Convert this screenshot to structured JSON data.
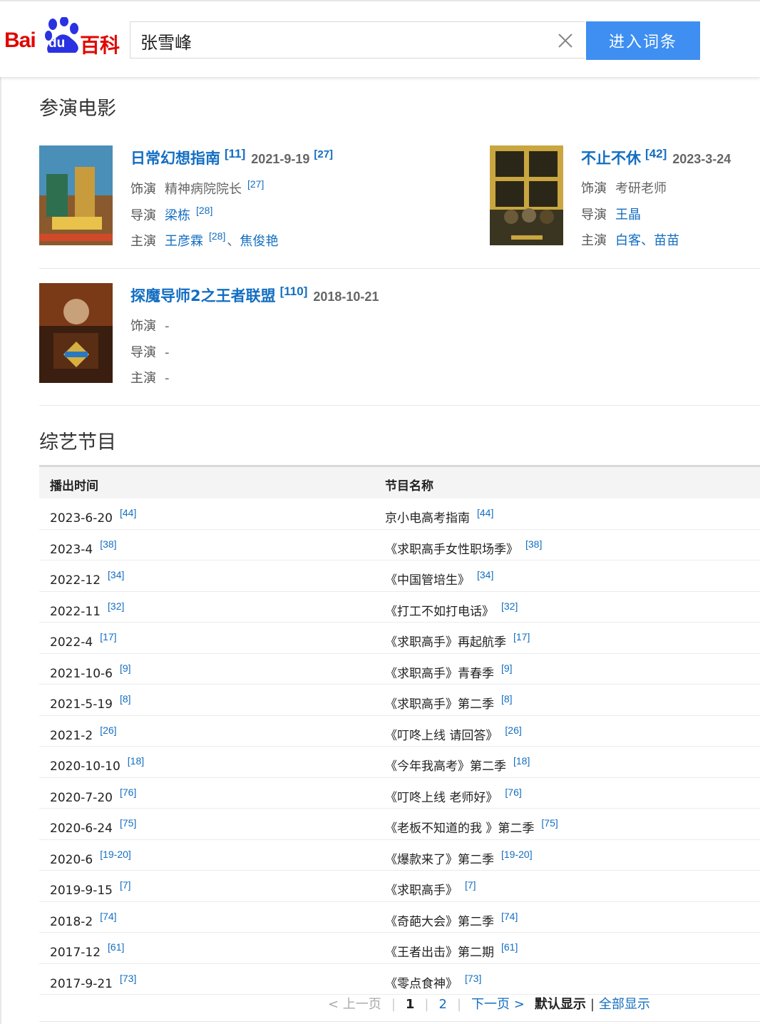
{
  "header": {
    "logo_bai": "Bai",
    "logo_du": "du",
    "logo_baike": "百科",
    "search_value": "张雪峰",
    "enter_button": "进入词条"
  },
  "films_section": {
    "title": "参演电影",
    "labels": {
      "role": "饰演",
      "director": "导演",
      "cast": "主演"
    },
    "films": [
      {
        "title": "日常幻想指南",
        "title_ref": "[11]",
        "date": "2021-9-19",
        "date_ref": "[27]",
        "role": "精神病院院长",
        "role_ref": "[27]",
        "director": "梁栋",
        "director_ref": "[28]",
        "cast_1": "王彦霖",
        "cast_1_ref": "[28]",
        "cast_sep": "、",
        "cast_2": "焦俊艳"
      },
      {
        "title": "不止不休",
        "title_ref": "[42]",
        "date": "2023-3-24",
        "role": "考研老师",
        "director": "王晶",
        "cast_1": "白客",
        "cast_sep": "、",
        "cast_2": "苗苗"
      },
      {
        "title": "探魔导师2之王者联盟",
        "title_ref": "[110]",
        "date": "2018-10-21",
        "role": "-",
        "director": "-",
        "cast": "-"
      }
    ]
  },
  "variety_section": {
    "title": "综艺节目",
    "headers": [
      "播出时间",
      "节目名称"
    ],
    "rows": [
      {
        "time": "2023-6-20",
        "time_ref": "[44]",
        "name": "京小电高考指南",
        "name_ref": "[44]"
      },
      {
        "time": "2023-4",
        "time_ref": "[38]",
        "name": "《求职高手女性职场季》",
        "name_ref": "[38]"
      },
      {
        "time": "2022-12",
        "time_ref": "[34]",
        "name": "《中国管培生》",
        "name_ref": "[34]"
      },
      {
        "time": "2022-11",
        "time_ref": "[32]",
        "name": "《打工不如打电话》",
        "name_ref": "[32]"
      },
      {
        "time": "2022-4",
        "time_ref": "[17]",
        "name": "《求职高手》再起航季",
        "name_ref": "[17]"
      },
      {
        "time": "2021-10-6",
        "time_ref": "[9]",
        "name": "《求职高手》青春季",
        "name_ref": "[9]"
      },
      {
        "time": "2021-5-19",
        "time_ref": "[8]",
        "name": "《求职高手》第二季",
        "name_ref": "[8]"
      },
      {
        "time": "2021-2",
        "time_ref": "[26]",
        "name": "《叮咚上线 请回答》",
        "name_ref": "[26]"
      },
      {
        "time": "2020-10-10",
        "time_ref": "[18]",
        "name": "《今年我高考》第二季",
        "name_ref": "[18]"
      },
      {
        "time": "2020-7-20",
        "time_ref": "[76]",
        "name": "《叮咚上线 老师好》",
        "name_ref": "[76]"
      },
      {
        "time": "2020-6-24",
        "time_ref": "[75]",
        "name": "《老板不知道的我 》第二季",
        "name_ref": "[75]"
      },
      {
        "time": "2020-6",
        "time_ref": "[19-20]",
        "name": "《爆款来了》第二季",
        "name_ref": "[19-20]"
      },
      {
        "time": "2019-9-15",
        "time_ref": "[7]",
        "name": "《求职高手》",
        "name_ref": "[7]"
      },
      {
        "time": "2018-2",
        "time_ref": "[74]",
        "name": "《奇葩大会》第二季",
        "name_ref": "[74]"
      },
      {
        "time": "2017-12",
        "time_ref": "[61]",
        "name": "《王者出击》第二期",
        "name_ref": "[61]"
      },
      {
        "time": "2017-9-21",
        "time_ref": "[73]",
        "name": "《零点食神》",
        "name_ref": "[73]"
      }
    ]
  },
  "pager": {
    "prev": "< 上一页",
    "page_1": "1",
    "page_2": "2",
    "next": "下一页 >",
    "default_display": "默认显示",
    "divider": "|",
    "show_all": "全部显示"
  }
}
